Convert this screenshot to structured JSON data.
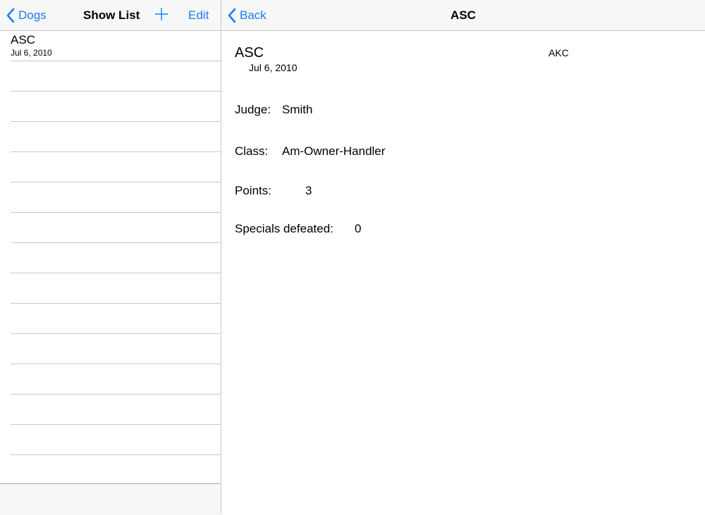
{
  "master": {
    "back_label": "Dogs",
    "title": "Show List",
    "edit_label": "Edit",
    "add_icon": "plus-icon",
    "rows": [
      {
        "title": "ASC",
        "subtitle": "Jul 6, 2010"
      },
      {
        "title": "",
        "subtitle": ""
      },
      {
        "title": "",
        "subtitle": ""
      },
      {
        "title": "",
        "subtitle": ""
      },
      {
        "title": "",
        "subtitle": ""
      },
      {
        "title": "",
        "subtitle": ""
      },
      {
        "title": "",
        "subtitle": ""
      },
      {
        "title": "",
        "subtitle": ""
      },
      {
        "title": "",
        "subtitle": ""
      },
      {
        "title": "",
        "subtitle": ""
      },
      {
        "title": "",
        "subtitle": ""
      },
      {
        "title": "",
        "subtitle": ""
      },
      {
        "title": "",
        "subtitle": ""
      },
      {
        "title": "",
        "subtitle": ""
      },
      {
        "title": "",
        "subtitle": ""
      }
    ]
  },
  "detail": {
    "back_label": "Back",
    "title": "ASC",
    "show_name": "ASC",
    "show_date": "Jul 6, 2010",
    "organization": "AKC",
    "judge_label": "Judge:",
    "judge_value": "Smith",
    "class_label": "Class:",
    "class_value": "Am-Owner-Handler",
    "points_label": "Points:",
    "points_value": "3",
    "specials_label": "Specials defeated:",
    "specials_value": "0"
  },
  "colors": {
    "accent": "#1a7cf5",
    "bar_background": "#f7f7f7",
    "separator": "#c8c7cc"
  }
}
